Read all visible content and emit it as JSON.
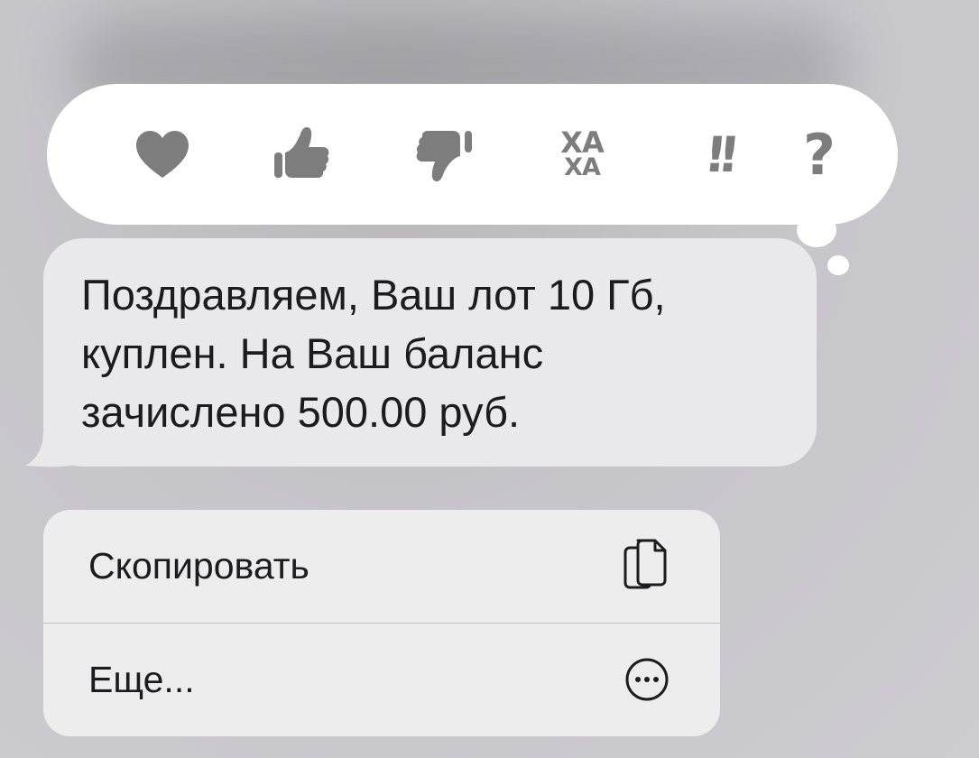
{
  "reactions": {
    "heart_icon": "heart-icon",
    "thumbs_up_icon": "thumbs-up-icon",
    "thumbs_down_icon": "thumbs-down-icon",
    "haha_line1": "ХА",
    "haha_line2": "ХА",
    "exclamation": "!!",
    "question": "?"
  },
  "message": {
    "text": "Поздравляем, Ваш лот 10 Гб,\nкуплен. На Ваш баланс\nзачислено 500.00 руб."
  },
  "menu": {
    "items": [
      {
        "label": "Скопировать",
        "icon": "copy-icon"
      },
      {
        "label": "Еще...",
        "icon": "more-icon"
      }
    ]
  },
  "colors": {
    "background": "#c8c7cc",
    "reaction_icon": "#7d7d7d",
    "bubble": "#e9e9eb",
    "menu": "#ededee",
    "text": "#1c1c1e"
  }
}
